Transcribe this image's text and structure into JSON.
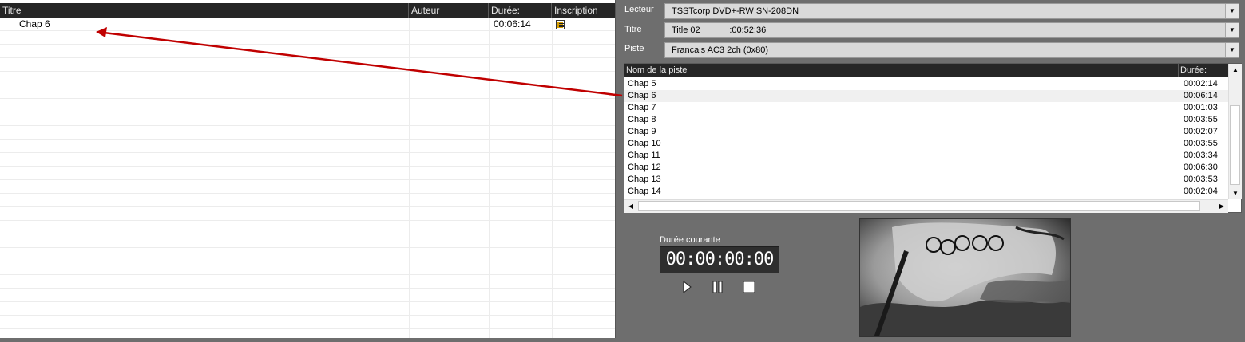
{
  "left_list": {
    "columns": [
      "Titre",
      "Auteur",
      "Durée:",
      "Inscription"
    ],
    "rows": [
      {
        "title": "Chap  6",
        "author": "",
        "duration": "00:06:14"
      }
    ]
  },
  "source": {
    "drive_label": "Lecteur",
    "drive_value": "TSSTcorp DVD+-RW SN-208DN",
    "title_label": "Titre",
    "title_value": "Title 02            :00:52:36",
    "track_label": "Piste",
    "track_value": "Francais AC3 2ch (0x80)"
  },
  "track_table": {
    "columns": [
      "Nom de la piste",
      "Durée:"
    ],
    "rows": [
      {
        "name": "Chap  5",
        "duration": "00:02:14"
      },
      {
        "name": "Chap  6",
        "duration": "00:06:14"
      },
      {
        "name": "Chap  7",
        "duration": "00:01:03"
      },
      {
        "name": "Chap  8",
        "duration": "00:03:55"
      },
      {
        "name": "Chap  9",
        "duration": "00:02:07"
      },
      {
        "name": "Chap 10",
        "duration": "00:03:55"
      },
      {
        "name": "Chap 11",
        "duration": "00:03:34"
      },
      {
        "name": "Chap 12",
        "duration": "00:06:30"
      },
      {
        "name": "Chap 13",
        "duration": "00:03:53"
      },
      {
        "name": "Chap 14",
        "duration": "00:02:04"
      }
    ],
    "selected_index": 1
  },
  "player": {
    "current_label": "Durée courante",
    "time": "00:00:00:00"
  },
  "icons": {
    "inscription": "inscription-icon",
    "play": "play-icon",
    "pause": "pause-icon",
    "stop": "stop-icon"
  },
  "colors": {
    "arrow": "#c00000",
    "header": "#262626",
    "background": "#6e6e6e"
  }
}
